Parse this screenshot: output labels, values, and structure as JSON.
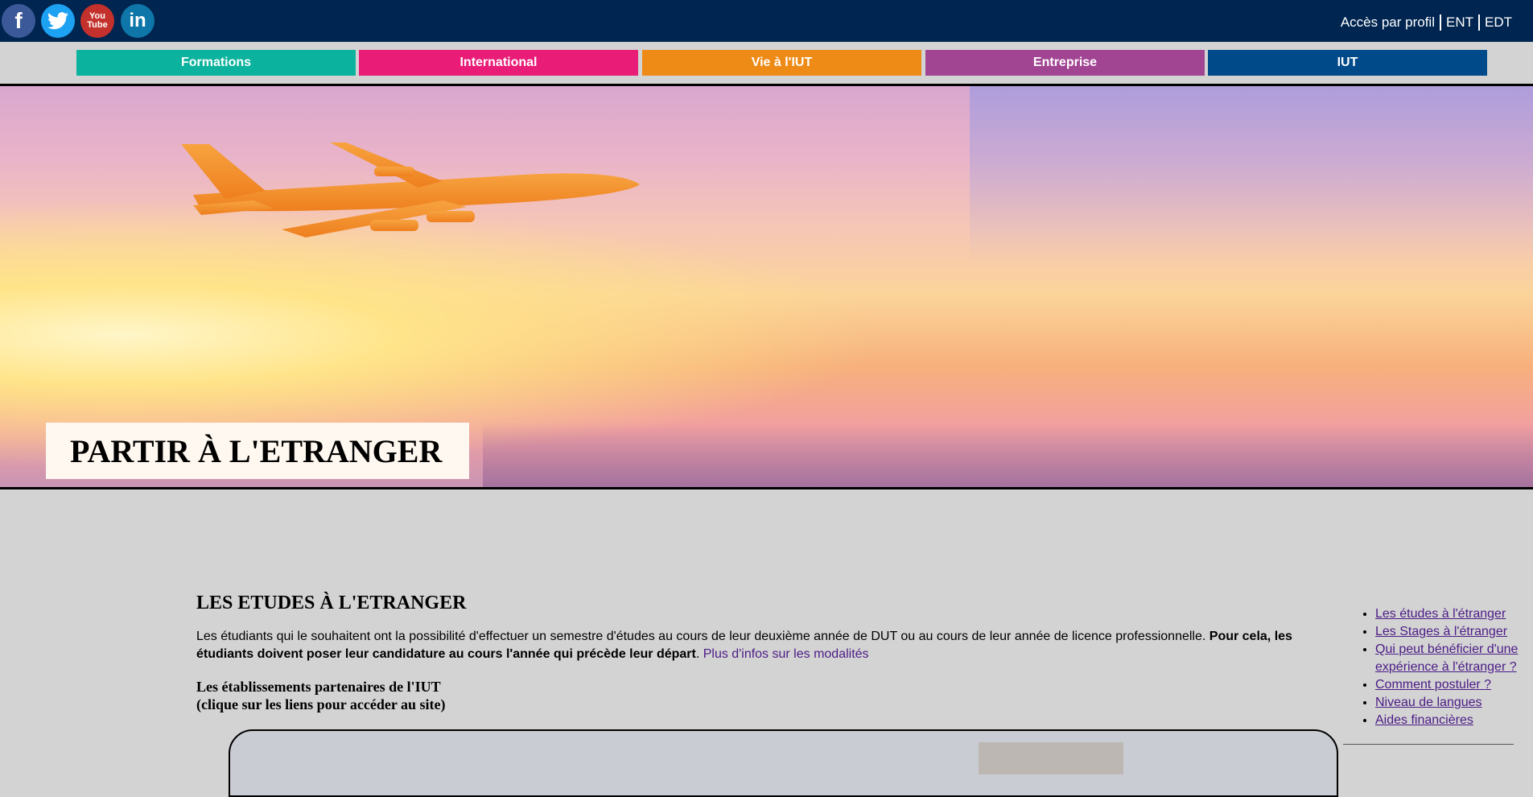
{
  "social": {
    "facebook": "f",
    "twitter": "twitter-icon",
    "youtube_line1": "You",
    "youtube_line2": "Tube",
    "linkedin": "in"
  },
  "top_links": [
    "Accès par profil",
    "ENT",
    "EDT"
  ],
  "nav": [
    "Formations",
    "International",
    "Vie à l'IUT",
    "Entreprise",
    "IUT"
  ],
  "colors": {
    "formations": "#0bb39e",
    "international": "#e91c77",
    "vie": "#ee8a16",
    "entreprise": "#a14593",
    "iut": "#014a8a",
    "topbar": "#002550",
    "link": "#4b1c86"
  },
  "hero": {
    "title": "PARTIR À L'ETRANGER"
  },
  "main": {
    "title": "LES ETUDES À L'ETRANGER",
    "text_normal": "Les étudiants qui le souhaitent ont la possibilité d'effectuer un semestre d'études au cours de leur deuxième année de DUT ou au cours de leur année de licence professionnelle. ",
    "text_bold": "Pour cela, les étudiants doivent poser leur candidature au cours l'année qui précède leur départ",
    "text_end": ". ",
    "more_link": "Plus d'infos sur les modalités",
    "partners_line1": "Les établissements partenaires de l'IUT",
    "partners_line2": "(clique sur les liens pour accéder au site)"
  },
  "sidebar": {
    "items": [
      "Les études à l'étranger",
      "Les Stages à l'étranger",
      "Qui peut bénéficier d'une expérience à l'étranger ?",
      "Comment postuler ?",
      "Niveau de langues",
      "Aides financières"
    ]
  }
}
